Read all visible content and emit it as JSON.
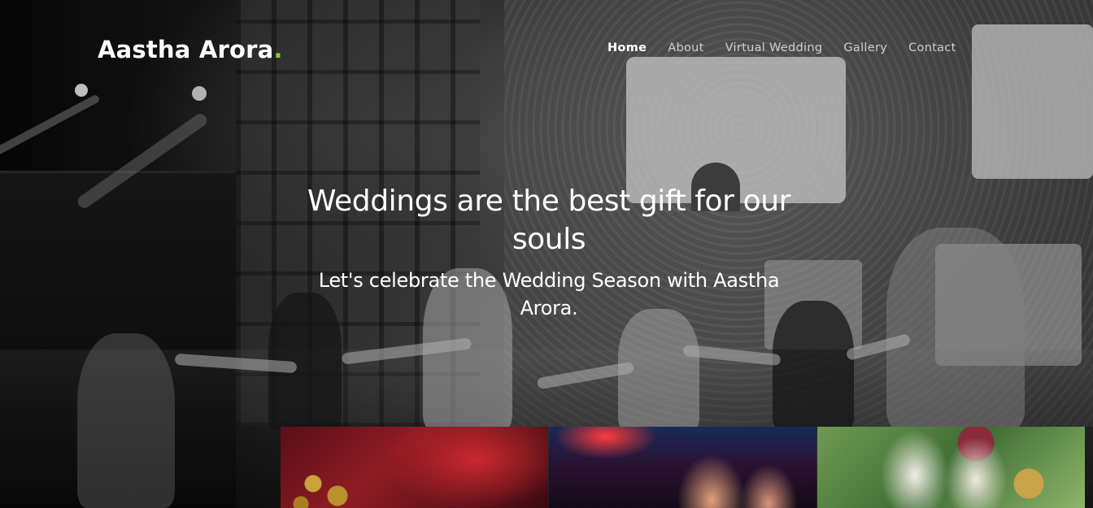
{
  "brand": {
    "name": "Aastha Arora",
    "dot": ".",
    "dot_color": "#8cc63f"
  },
  "nav": {
    "items": [
      {
        "label": "Home",
        "active": true
      },
      {
        "label": "About",
        "active": false
      },
      {
        "label": "Virtual Wedding",
        "active": false
      },
      {
        "label": "Gallery",
        "active": false
      },
      {
        "label": "Contact",
        "active": false
      }
    ]
  },
  "hero": {
    "title": "Weddings are the best gift for our souls",
    "subtitle": "Let's celebrate the Wedding Season with Aastha Arora."
  },
  "gallery": {
    "thumbnails": [
      {
        "name": "gallery-thumb-sangeet-red"
      },
      {
        "name": "gallery-thumb-dance-party"
      },
      {
        "name": "gallery-thumb-bride-groom"
      }
    ]
  }
}
